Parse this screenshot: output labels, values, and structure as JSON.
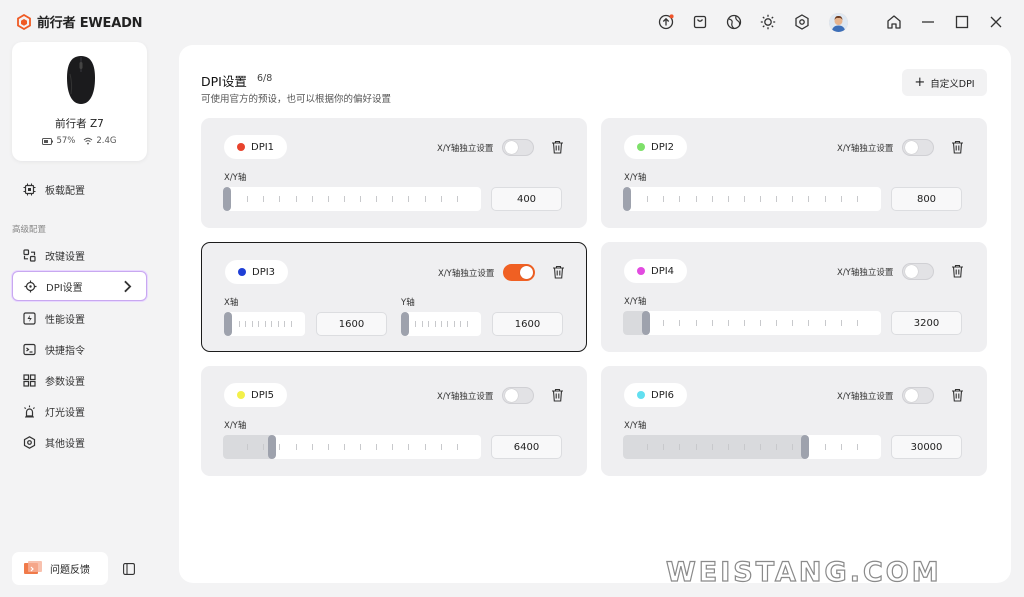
{
  "app": {
    "brand": "前行者 EWEADN"
  },
  "device": {
    "name": "前行者 Z7",
    "battery": "57%",
    "connection": "2.4G"
  },
  "sidebar": {
    "top_item": {
      "label": "板载配置"
    },
    "section_label": "高级配置",
    "items": [
      {
        "label": "改键设置"
      },
      {
        "label": "DPI设置"
      },
      {
        "label": "性能设置"
      },
      {
        "label": "快捷指令"
      },
      {
        "label": "参数设置"
      },
      {
        "label": "灯光设置"
      },
      {
        "label": "其他设置"
      }
    ],
    "feedback_label": "问题反馈"
  },
  "page": {
    "title": "DPI设置",
    "count": "6/8",
    "subtitle": "可使用官方的预设，也可以根据你的偏好设置",
    "add_label": "自定义DPI"
  },
  "independent_label": "X/Y轴独立设置",
  "xy_label": "X/Y轴",
  "x_label": "X轴",
  "y_label": "Y轴",
  "dpi_cards": [
    {
      "name": "DPI1",
      "color": "#e8432d",
      "value": "400",
      "fraction": 0.0,
      "independent": false
    },
    {
      "name": "DPI2",
      "color": "#7ee06a",
      "value": "800",
      "fraction": 0.0,
      "independent": false
    },
    {
      "name": "DPI3",
      "color": "#1f3fd6",
      "x_value": "1600",
      "y_value": "1600",
      "x_fraction": 0.0,
      "y_fraction": 0.0,
      "independent": true,
      "selected": true
    },
    {
      "name": "DPI4",
      "color": "#e24be0",
      "value": "3200",
      "fraction": 0.075,
      "independent": false
    },
    {
      "name": "DPI5",
      "color": "#f3f04a",
      "value": "6400",
      "fraction": 0.18,
      "independent": false
    },
    {
      "name": "DPI6",
      "color": "#62dff0",
      "value": "30000",
      "fraction": 0.71,
      "independent": false
    }
  ],
  "watermark": "WEISTANG.COM"
}
